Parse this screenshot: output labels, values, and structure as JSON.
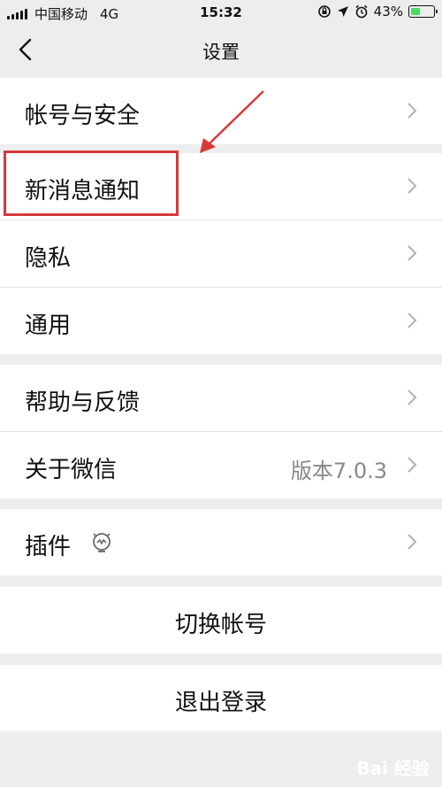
{
  "status_bar": {
    "carrier": "中国移动",
    "network": "4G",
    "time": "15:32",
    "battery_percent": "43%",
    "battery_level": 0.43
  },
  "navbar": {
    "title": "设置",
    "back_icon": "chevron-left-icon"
  },
  "groups": [
    {
      "rows": [
        {
          "label": "帐号与安全"
        }
      ]
    },
    {
      "rows": [
        {
          "label": "新消息通知"
        },
        {
          "label": "隐私"
        },
        {
          "label": "通用"
        }
      ]
    },
    {
      "rows": [
        {
          "label": "帮助与反馈"
        },
        {
          "label": "关于微信",
          "value": "版本7.0.3"
        }
      ]
    },
    {
      "rows": [
        {
          "label": "插件",
          "icon": "plugin-icon"
        }
      ]
    }
  ],
  "actions": {
    "switch_account": "切换帐号",
    "logout": "退出登录"
  },
  "annotation": {
    "highlight_color": "#d63a3a"
  },
  "watermark": "Bai 经验"
}
